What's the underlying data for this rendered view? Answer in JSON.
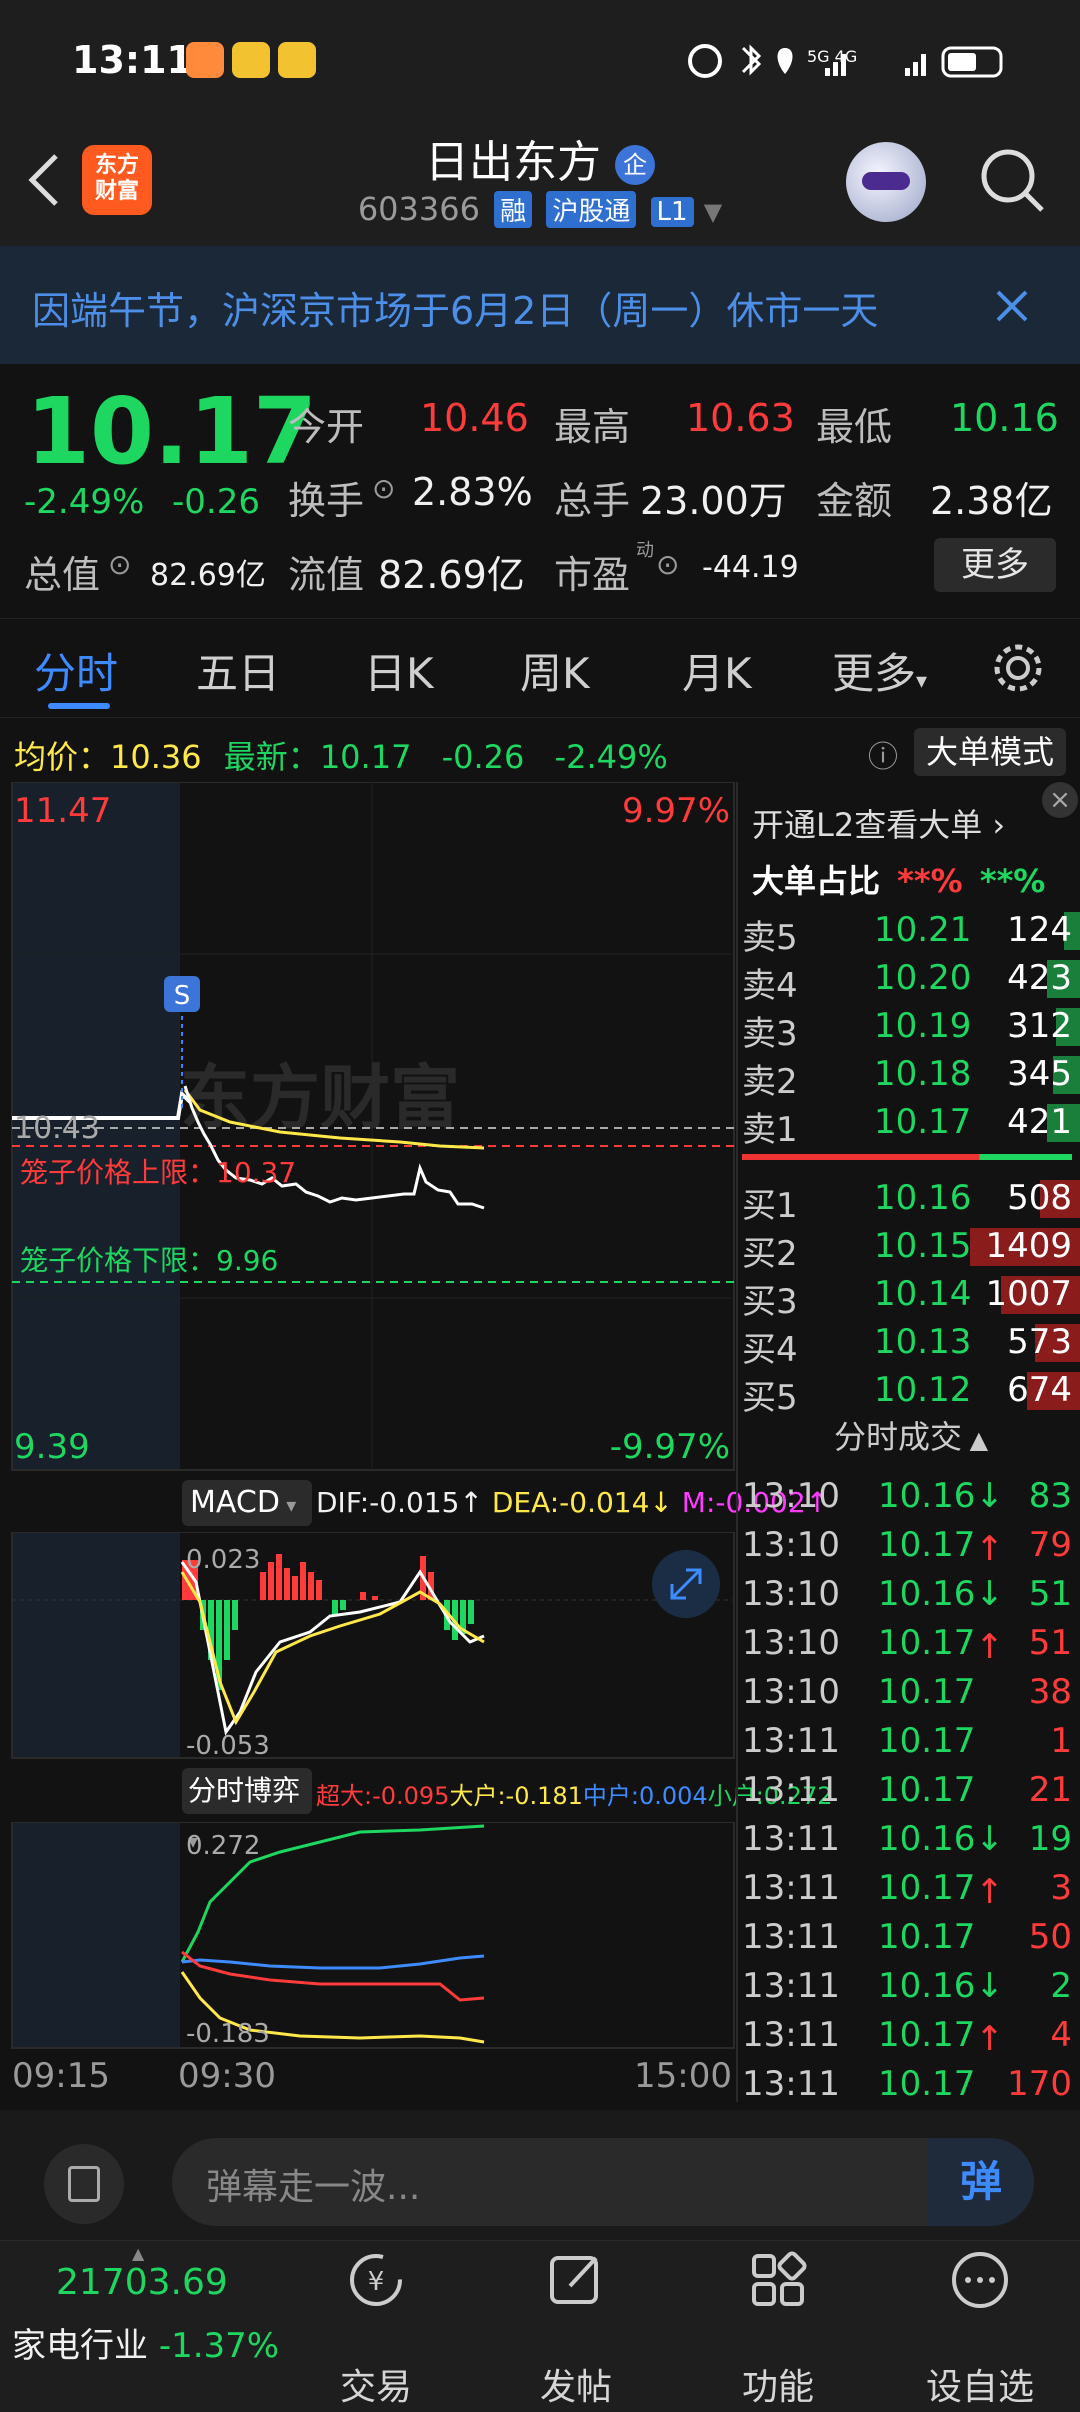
{
  "status_bar": {
    "time": "13:11",
    "network": "5G 4G"
  },
  "header": {
    "logo_text": "东方\n财富",
    "name": "日出东方",
    "name_badge": "企",
    "code": "603366",
    "tags": [
      "融",
      "沪股通",
      "L1"
    ]
  },
  "notice": {
    "text": "因端午节，沪深京市场于6月2日（周一）休市一天"
  },
  "quote": {
    "price": "10.17",
    "change_pct": "-2.49%",
    "change": "-0.26",
    "open_label": "今开",
    "open": "10.46",
    "high_label": "最高",
    "high": "10.63",
    "low_label": "最低",
    "low": "10.16",
    "turnover_label": "换手",
    "turnover": "2.83%",
    "volume_label": "总手",
    "volume": "23.00万",
    "amount_label": "金额",
    "amount": "2.38亿",
    "mktcap_label": "总值",
    "mktcap": "82.69亿",
    "float_label": "流值",
    "float": "82.69亿",
    "pe_label": "市盈",
    "pe_sup": "动",
    "pe": "-44.19",
    "more": "更多"
  },
  "tabs": [
    "分时",
    "五日",
    "日K",
    "周K",
    "月K",
    "更多"
  ],
  "info_bar": {
    "avg_label": "均价：",
    "avg": "10.36",
    "latest_label": "最新：",
    "latest": "10.17",
    "chg": "-0.26",
    "pct": "-2.49%",
    "big_mode": "大单模式"
  },
  "chart": {
    "y_top": "11.47",
    "y_bottom": "9.39",
    "pct_top": "9.97%",
    "pct_bottom": "-9.97%",
    "prev_close": "10.43",
    "cage_upper_label": "笼子价格上限：",
    "cage_upper": "10.37",
    "cage_lower_label": "笼子价格下限：",
    "cage_lower": "9.96",
    "s_marker": "S",
    "watermark": "东方财富",
    "time_start": "09:15",
    "time_open": "09:30",
    "time_end": "15:00"
  },
  "macd": {
    "label": "MACD",
    "dif": "DIF:-0.015↑",
    "dea": "DEA:-0.014↓",
    "m": "M:-0.002↑",
    "top": "0.023",
    "bottom": "-0.053"
  },
  "game": {
    "label": "分时博弈",
    "super": "超大:-0.095",
    "big": "大户:-0.181",
    "mid": "中户:0.004",
    "small": "小户:0.272",
    "top": "0.272",
    "bottom": "-0.183"
  },
  "order_panel": {
    "open_l2": "开通L2查看大单",
    "ratio_label": "大单占比",
    "ratio_red": "**%",
    "ratio_green": "**%",
    "asks": [
      {
        "label": "卖5",
        "price": "10.21",
        "vol": "124"
      },
      {
        "label": "卖4",
        "price": "10.20",
        "vol": "423"
      },
      {
        "label": "卖3",
        "price": "10.19",
        "vol": "312"
      },
      {
        "label": "卖2",
        "price": "10.18",
        "vol": "345"
      },
      {
        "label": "卖1",
        "price": "10.17",
        "vol": "421"
      }
    ],
    "bids": [
      {
        "label": "买1",
        "price": "10.16",
        "vol": "508"
      },
      {
        "label": "买2",
        "price": "10.15",
        "vol": "1409"
      },
      {
        "label": "买3",
        "price": "10.14",
        "vol": "1007"
      },
      {
        "label": "买4",
        "price": "10.13",
        "vol": "573"
      },
      {
        "label": "买5",
        "price": "10.12",
        "vol": "674"
      }
    ],
    "ticks_title": "分时成交",
    "ticks": [
      {
        "t": "13:10",
        "p": "10.16↓",
        "v": "83",
        "dir": "down"
      },
      {
        "t": "13:10",
        "p": "10.17↑",
        "v": "79",
        "dir": "up"
      },
      {
        "t": "13:10",
        "p": "10.16↓",
        "v": "51",
        "dir": "down"
      },
      {
        "t": "13:10",
        "p": "10.17↑",
        "v": "51",
        "dir": "up"
      },
      {
        "t": "13:10",
        "p": "10.17",
        "v": "38",
        "dir": "up"
      },
      {
        "t": "13:11",
        "p": "10.17",
        "v": "1",
        "dir": "up"
      },
      {
        "t": "13:11",
        "p": "10.17",
        "v": "21",
        "dir": "up"
      },
      {
        "t": "13:11",
        "p": "10.16↓",
        "v": "19",
        "dir": "down"
      },
      {
        "t": "13:11",
        "p": "10.17↑",
        "v": "3",
        "dir": "up"
      },
      {
        "t": "13:11",
        "p": "10.17",
        "v": "50",
        "dir": "up"
      },
      {
        "t": "13:11",
        "p": "10.16↓",
        "v": "2",
        "dir": "down"
      },
      {
        "t": "13:11",
        "p": "10.17↑",
        "v": "4",
        "dir": "up"
      },
      {
        "t": "13:11",
        "p": "10.17",
        "v": "170",
        "dir": "up"
      }
    ]
  },
  "danmu": {
    "placeholder": "弹幕走一波...",
    "button": "弹"
  },
  "bottom_nav": {
    "index_value": "21703.69",
    "index_name": "家电行业",
    "index_pct": "-1.37%",
    "items": [
      "交易",
      "发帖",
      "功能",
      "设自选"
    ]
  },
  "colors": {
    "up": "#ff3b3b",
    "down": "#1ed760",
    "accent": "#3d8bff",
    "avg_line": "#ffe94a"
  }
}
